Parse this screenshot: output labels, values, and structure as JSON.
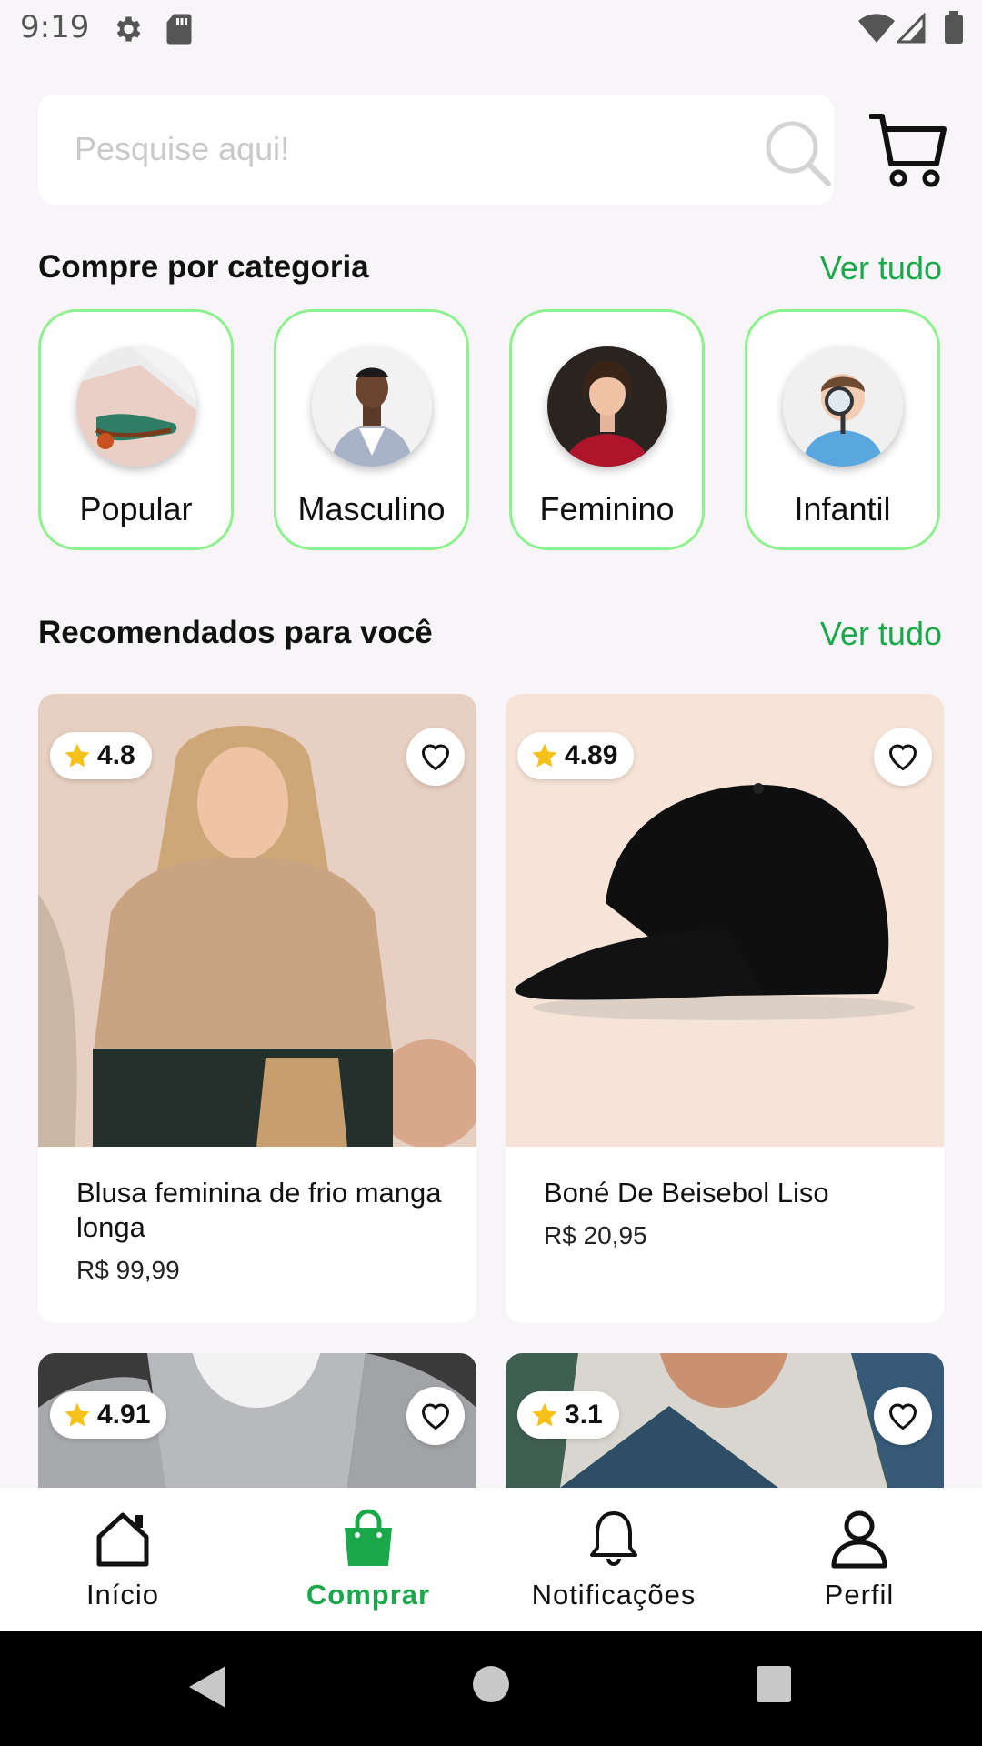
{
  "status_bar": {
    "time": "9:19"
  },
  "search": {
    "placeholder": "Pesquise aqui!"
  },
  "categories_section": {
    "title": "Compre por categoria",
    "see_all": "Ver tudo",
    "items": [
      {
        "label": "Popular"
      },
      {
        "label": "Masculino"
      },
      {
        "label": "Feminino"
      },
      {
        "label": "Infantil"
      }
    ]
  },
  "recommended_section": {
    "title": "Recomendados para você",
    "see_all": "Ver tudo",
    "products": [
      {
        "rating": "4.8",
        "name": "Blusa feminina de frio manga longa",
        "price": "R$ 99,99"
      },
      {
        "rating": "4.89",
        "name": "Boné De Beisebol Liso",
        "price": "R$ 20,95"
      },
      {
        "rating": "4.91"
      },
      {
        "rating": "3.1"
      }
    ]
  },
  "bottom_nav": {
    "items": [
      {
        "label": "Início",
        "icon": "home-icon"
      },
      {
        "label": "Comprar",
        "icon": "shopping-bag-icon",
        "active": true
      },
      {
        "label": "Notificações",
        "icon": "bell-icon"
      },
      {
        "label": "Perfil",
        "icon": "user-icon"
      }
    ]
  },
  "colors": {
    "accent": "#1aa84b",
    "category_border": "#8ff08f",
    "background": "#f7f5f8"
  }
}
